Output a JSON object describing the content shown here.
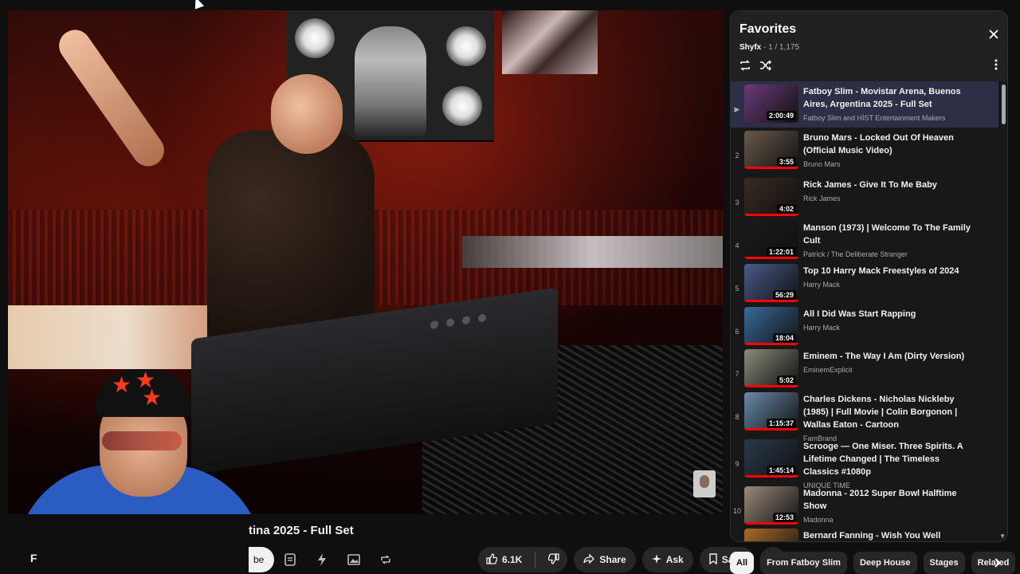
{
  "video": {
    "title_visible": "tina 2025 - Full Set",
    "channel_initial": "F",
    "subscribe_label": "be"
  },
  "actions": {
    "like_count": "6.1K",
    "share_label": "Share",
    "ask_label": "Ask",
    "save_label": "Save",
    "more_label": "..."
  },
  "playlist": {
    "title": "Favorites",
    "owner": "Shyfx",
    "position": " - 1 / 1,175",
    "items": [
      {
        "index": "▶",
        "title": "Fatboy Slim - Movistar Arena, Buenos Aires, Argentina 2025 - Full Set",
        "channel": "Fatboy Slim and HİST Entertainment Makers",
        "duration": "2:00:49",
        "active": true,
        "thumb": "#6b3a7a"
      },
      {
        "index": "2",
        "title": "Bruno Mars - Locked Out Of Heaven (Official Music Video)",
        "channel": "Bruno Mars",
        "duration": "3:55",
        "thumb": "#6a5a4a"
      },
      {
        "index": "3",
        "title": "Rick James - Give It To Me Baby",
        "channel": "Rick James",
        "duration": "4:02",
        "thumb": "#3a2a22"
      },
      {
        "index": "4",
        "title": "Manson (1973) | Welcome To The Family Cult",
        "channel": "Patrick / The Deliberate Stranger",
        "duration": "1:22:01",
        "thumb": "#1a1a1a"
      },
      {
        "index": "5",
        "title": "Top 10 Harry Mack Freestyles of 2024",
        "channel": "Harry Mack",
        "duration": "56:29",
        "thumb": "#4a5a8a"
      },
      {
        "index": "6",
        "title": "All I Did Was Start Rapping",
        "channel": "Harry Mack",
        "duration": "18:04",
        "thumb": "#3a6a9a"
      },
      {
        "index": "7",
        "title": "Eminem - The Way I Am (Dirty Version)",
        "channel": "EminemExplicit",
        "duration": "5:02",
        "thumb": "#8a8a7a"
      },
      {
        "index": "8",
        "title": "Charles Dickens - Nicholas Nickleby (1985) | Full Movie | Colin Borgonon | Wallas Eaton - Cartoon",
        "channel": "FamBrand",
        "duration": "1:15:37",
        "thumb": "#6a8aaa"
      },
      {
        "index": "9",
        "title": "Scrooge — One Miser. Three Spirits. A Lifetime Changed | The Timeless Classics #1080p",
        "channel": "UNIQUE TIME",
        "duration": "1:45:14",
        "thumb": "#2a3a4a"
      },
      {
        "index": "10",
        "title": "Madonna - 2012 Super Bowl Halftime Show",
        "channel": "Madonna",
        "duration": "12:53",
        "thumb": "#9a8a7a"
      },
      {
        "index": "",
        "title": "Bernard Fanning - Wish You Well",
        "channel": "",
        "duration": "",
        "thumb": "#aa6a2a"
      }
    ]
  },
  "chips": [
    "All",
    "From Fatboy Slim",
    "Deep House",
    "Stages",
    "Related"
  ],
  "icons": {
    "close": "close-icon",
    "loop": "loop-icon",
    "shuffle": "shuffle-icon",
    "more": "more-vert-icon",
    "like": "thumbs-up-icon",
    "dislike": "thumbs-down-icon",
    "share": "share-icon",
    "ask": "sparkle-icon",
    "save": "bookmark-icon"
  }
}
